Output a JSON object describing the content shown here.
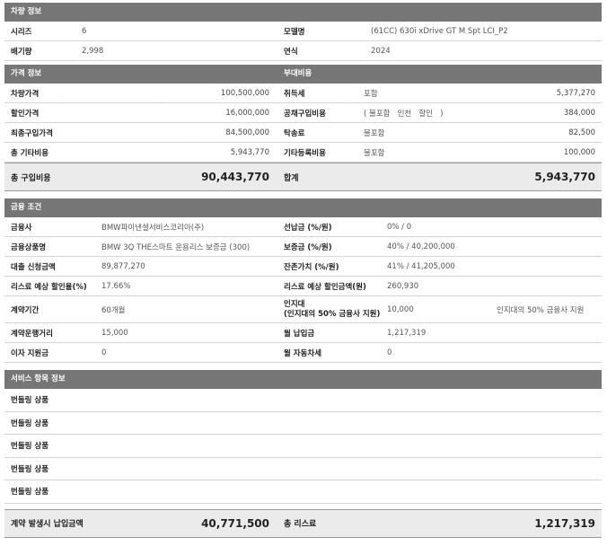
{
  "vehicle": {
    "header": "차량 정보",
    "series_label": "시리즈",
    "series_value": "6",
    "model_label": "모델명",
    "model_value": "(61CC) 630i xDrive GT M Spt LCI_P2",
    "displacement_label": "배기량",
    "displacement_value": "2,998",
    "year_label": "연식",
    "year_value": "2024"
  },
  "price": {
    "header_left": "가격 정보",
    "header_right": "부대비용",
    "rows": [
      {
        "label": "차량가격",
        "value": "100,500,000",
        "r_label": "취득세",
        "r_note": "포함",
        "r_value": "5,377,270"
      },
      {
        "label": "할인가격",
        "value": "16,000,000",
        "r_label": "공채구입비용",
        "r_note": "( 불포함   인천   할인   )",
        "r_value": "384,000"
      },
      {
        "label": "최종구입가격",
        "value": "84,500,000",
        "r_label": "탁송료",
        "r_note": "불포함",
        "r_value": "82,500"
      },
      {
        "label": "총 기타비용",
        "value": "5,943,770",
        "r_label": "기타등록비용",
        "r_note": "불포함",
        "r_value": "100,000"
      }
    ],
    "total_label": "총 구입비용",
    "total_value": "90,443,770",
    "sum_label": "합계",
    "sum_value": "5,943,770"
  },
  "finance": {
    "header": "금융 조건",
    "rows": [
      {
        "label": "금융사",
        "value": "BMW파이낸셜서비스코리아(주)",
        "r_label": "선납금 (%/원)",
        "r_value": "0% / 0",
        "r_note": ""
      },
      {
        "label": "금융상품명",
        "value": "BMW 3Q THE스마트 운용리스 보증금 (300)",
        "r_label": "보증금 (%/원)",
        "r_value": "40% / 40,200,000",
        "r_note": ""
      },
      {
        "label": "대출 신청금액",
        "value": "89,877,270",
        "r_label": "잔존가치 (%/원)",
        "r_value": "41% / 41,205,000",
        "r_note": ""
      },
      {
        "label": "리스료 예상 할인율(%)",
        "value": "17.66%",
        "r_label": "리스료 예상 할인금액(원)",
        "r_value": "260,930",
        "r_note": ""
      }
    ],
    "term_label": "계약기간",
    "term_value": "60개월",
    "deposit_label_1": "인지대",
    "deposit_label_2": "(인지대의 50% 금융사 지원)",
    "deposit_value": "10,000",
    "deposit_note": "인지대의 50% 금융사 지원",
    "distance_label": "계약운행거리",
    "distance_value": "15,000",
    "monthly_label": "월 납입금",
    "monthly_value": "1,217,319",
    "interest_label": "이자 지원금",
    "interest_value": "0",
    "autopay_label": "월 자동차세",
    "autopay_value": "0"
  },
  "service": {
    "header": "서비스 항목 정보",
    "items": [
      "번들링 상품",
      "번들링 상품",
      "번들링 상품",
      "번들링 상품",
      "번들링 상품"
    ]
  },
  "footer": {
    "initial_label": "계약 발생시 납입금액",
    "initial_value": "40,771,500",
    "lease_label": "총 리스료",
    "lease_value": "1,217,319"
  }
}
